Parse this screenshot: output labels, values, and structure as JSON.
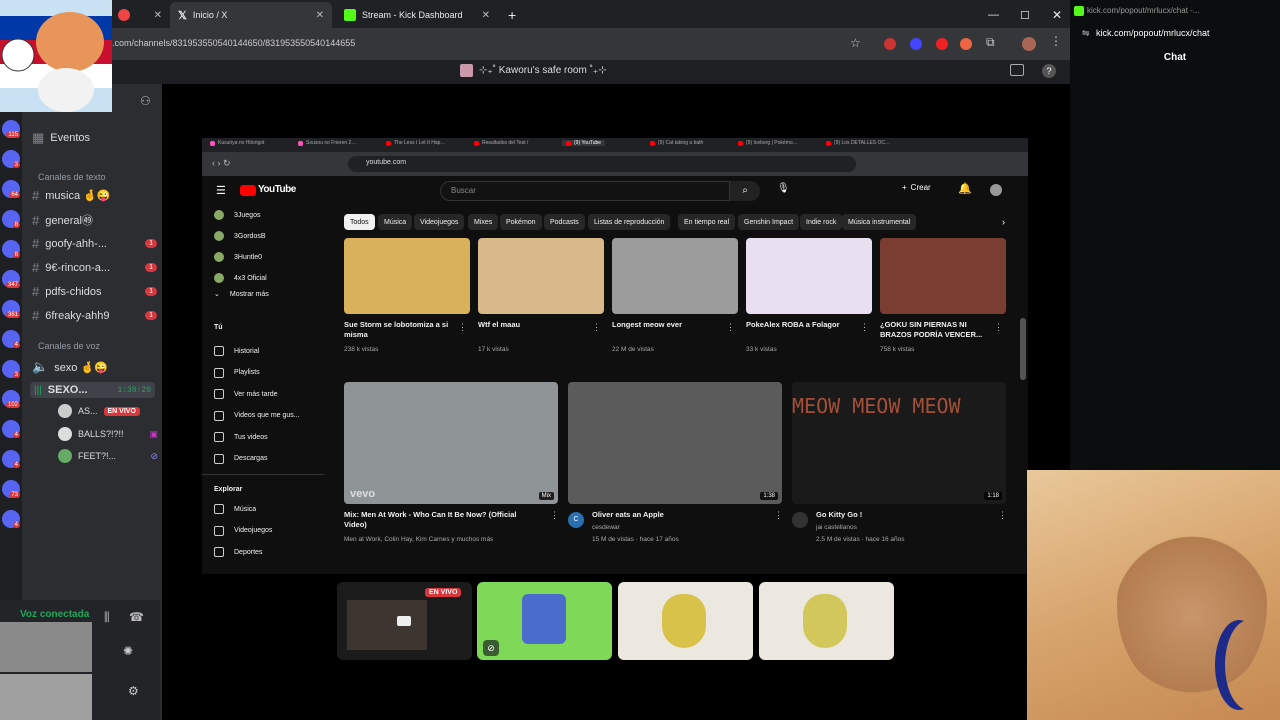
{
  "browser": {
    "tabs": [
      {
        "label": "Inicio / X"
      },
      {
        "label": "Stream - Kick Dashboard"
      }
    ],
    "url": ".com/channels/831953550540144650/831953550540144655"
  },
  "discord": {
    "server_title": "⊹₊˚ Kaworu's safe room ˚₊⊹",
    "events": "Eventos",
    "text_category": "Canales de texto",
    "text_channels": [
      {
        "name": "musica 🤞😜",
        "badge": ""
      },
      {
        "name": "general㊾",
        "badge": ""
      },
      {
        "name": "goofy-ahh-...",
        "badge": "1"
      },
      {
        "name": "9€-rincon-a...",
        "badge": "1"
      },
      {
        "name": "pdfs-chidos",
        "badge": "1"
      },
      {
        "name": "6freaky-ahh9",
        "badge": "1"
      }
    ],
    "voice_category": "Canales de voz",
    "voice_channels": [
      {
        "name": "sexo 🤞😜"
      },
      {
        "name": "SEXO...",
        "timer": "1:38:20"
      }
    ],
    "voice_users": [
      {
        "name": "AS...",
        "live": "EN VIVO"
      },
      {
        "name": "BALLS?!?!!"
      },
      {
        "name": "FEET?!..."
      }
    ],
    "voice_connected": "Voz conectada",
    "server_badges": [
      "115",
      "3",
      "64",
      "8",
      "8",
      "347",
      "361",
      "4",
      "3",
      "102",
      "4",
      "4",
      "73",
      "4"
    ]
  },
  "youtube": {
    "tabs": [
      "Kusuriya no Hitorigot",
      "Sousou no Frieren 2…",
      "The Less I Let It Hap…",
      "Resultados del Test /",
      "(9) YouTube",
      "(9) Cat taking a bath",
      "(9) Iceberg | Pokémo…",
      "(9) Los DETALLES OC…"
    ],
    "url": "youtube.com",
    "search_placeholder": "Buscar",
    "create": "Crear",
    "chips": [
      "Todos",
      "Música",
      "Videojuegos",
      "Mixes",
      "Pokémon",
      "Podcasts",
      "Listas de reproducción",
      "En tiempo real",
      "Genshin Impact",
      "Indie rock",
      "Música instrumental"
    ],
    "sidebar": {
      "subs": [
        "3Juegos",
        "3GordosB",
        "3Huntle0",
        "4x3 Oficial"
      ],
      "more": "Mostrar más",
      "you": "Tú",
      "you_items": [
        "Historial",
        "Playlists",
        "Ver más tarde",
        "Videos que me gus...",
        "Tus videos",
        "Descargas"
      ],
      "explore": "Explorar",
      "explore_items": [
        "Música",
        "Videojuegos",
        "Deportes"
      ]
    },
    "row1": [
      {
        "title": "Sue Storm se lobotomiza a si misma",
        "views": "238 k vistas"
      },
      {
        "title": "Wtf el maau",
        "views": "17 k vistas"
      },
      {
        "title": "Longest meow ever",
        "views": "22 M de vistas"
      },
      {
        "title": "PokeAlex ROBA a Folagor",
        "views": "33 k vistas"
      },
      {
        "title": "¿GOKU SIN PIERNAS NI BRAZOS PODRÍA VENCER...",
        "views": "758 k vistas"
      }
    ],
    "row2": [
      {
        "title": "Mix: Men At Work - Who Can It Be Now? (Official Video)",
        "channel": "Men at Work, Colin Hay, Kim Carnes y muchos más",
        "stats": "",
        "badge": "Mix",
        "logo": "vevo"
      },
      {
        "title": "Oliver eats an Apple",
        "channel": "cesdewar",
        "stats": "15 M de vistas · hace 17 años",
        "badge": "1:38",
        "avatar": "C"
      },
      {
        "title": "Go Kitty Go !",
        "channel": "jai castellanos",
        "stats": "2.5 M de vistas · hace 16 años",
        "badge": "1:18",
        "overlay": "MEOW MEOW MEOW"
      }
    ]
  },
  "tiles": {
    "live": "EN VIVO"
  },
  "chat": {
    "url": "kick.com/popout/mrlucx/chat",
    "url_short": "kick.com/popout/mrlucx/chat -...",
    "title": "Chat"
  },
  "colors": {
    "yt_red": "#ff0000",
    "kick_green": "#53fc18",
    "discord_red": "#da373c",
    "tile_green": "#7ed957"
  }
}
